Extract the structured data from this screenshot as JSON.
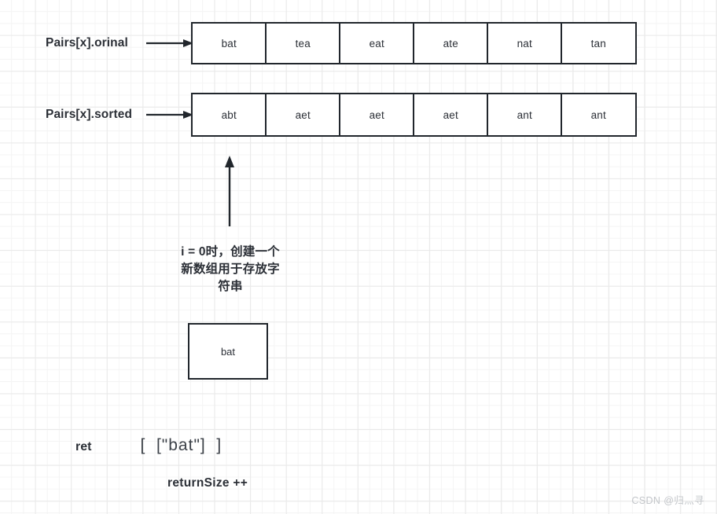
{
  "diagram": {
    "title": "Anagram grouping Pairs array walkthrough",
    "colors": {
      "stroke": "#21262c",
      "text": "#2b2f36",
      "background": "#ffffff",
      "grid_minor": "#f4f4f4",
      "grid_major": "#e9e9e9",
      "watermark": "#c3c6ca"
    },
    "rows": [
      {
        "key": "original",
        "label": "Pairs[x].orinal",
        "cells": [
          "bat",
          "tea",
          "eat",
          "ate",
          "nat",
          "tan"
        ]
      },
      {
        "key": "sorted",
        "label": "Pairs[x].sorted",
        "cells": [
          "abt",
          "aet",
          "aet",
          "aet",
          "ant",
          "ant"
        ]
      }
    ],
    "annotation": {
      "line1": "i = 0时，创建一个",
      "line2": "新数组用于存放字",
      "line3": "符串"
    },
    "result_box": {
      "value": "bat"
    },
    "ret": {
      "label": "ret",
      "value": "[  [\"bat\"]  ]"
    },
    "return_size": {
      "text": "returnSize ++"
    },
    "watermark": {
      "text": "CSDN @归灬寻"
    },
    "arrows": {
      "to_original": "arrow-right",
      "to_sorted": "arrow-right",
      "up_from_annotation": "arrow-up"
    }
  }
}
